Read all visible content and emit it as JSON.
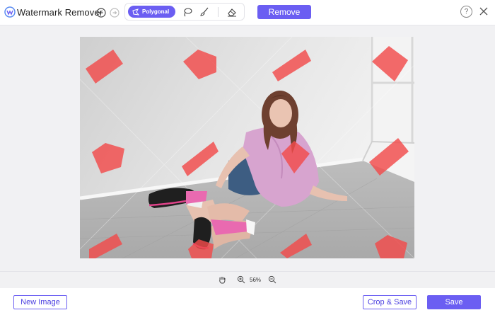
{
  "app": {
    "title": "Watermark Remover"
  },
  "toolbar": {
    "undo_icon": "undo-icon",
    "redo_icon": "redo-icon",
    "polygonal_label": "Polygonal",
    "lasso_icon": "lasso-icon",
    "brush_icon": "brush-icon",
    "eraser_icon": "eraser-icon",
    "remove_label": "Remove",
    "help_label": "?",
    "close_icon": "close-icon"
  },
  "canvas": {
    "selection_color": "#f24b4b",
    "accent": "#6b5ef2"
  },
  "zoom": {
    "level": "56%"
  },
  "footer": {
    "new_image_label": "New Image",
    "crop_save_label": "Crop & Save",
    "save_label": "Save"
  }
}
